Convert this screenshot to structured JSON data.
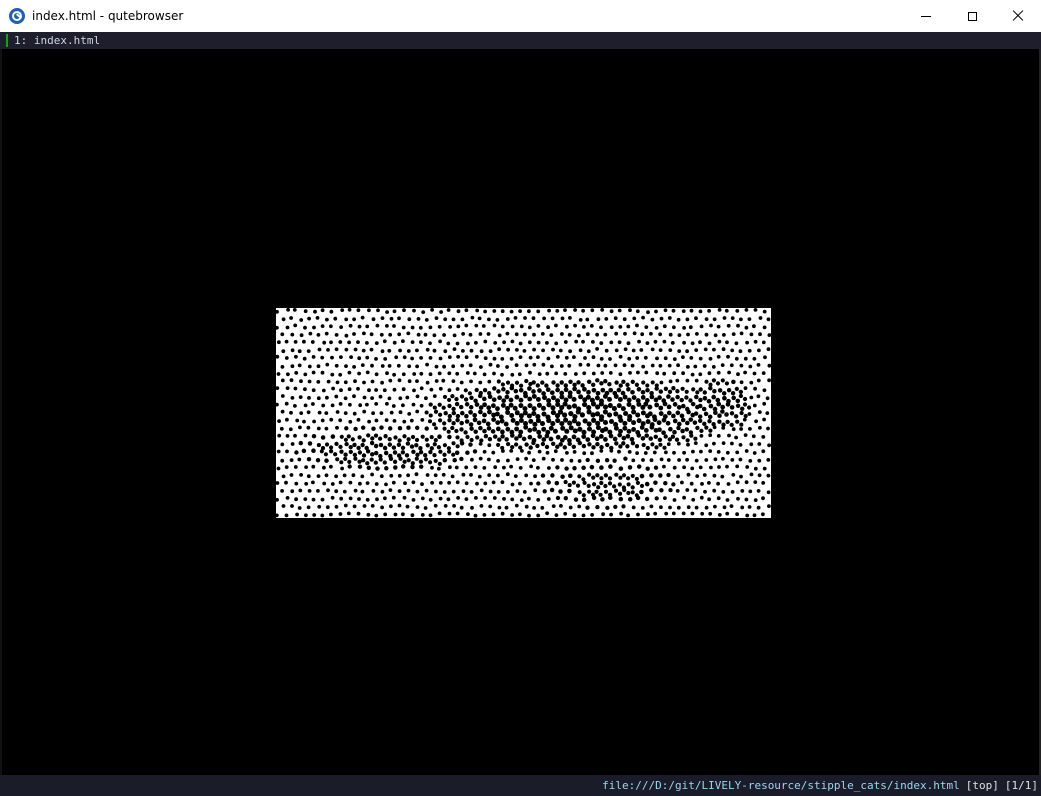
{
  "window": {
    "title": "index.html - qutebrowser",
    "app_icon": "qutebrowser-icon",
    "controls": {
      "minimize": "minimize-icon",
      "maximize": "maximize-icon",
      "close": "close-icon"
    }
  },
  "tabs": [
    {
      "label": "1: index.html",
      "active": true
    }
  ],
  "content": {
    "image_description_icon": "stipple-cat-image"
  },
  "statusbar": {
    "url": "file:///D:/git/LIVELY-resource/stipple_cats/index.html",
    "scroll": "[top]",
    "tab_count": "[1/1]"
  },
  "colors": {
    "tab_indicator": "#14a11c",
    "url_text": "#99d7ee",
    "statusbar_bg": "#1b1c2a",
    "tabbar_bg": "#1e1e2c"
  }
}
